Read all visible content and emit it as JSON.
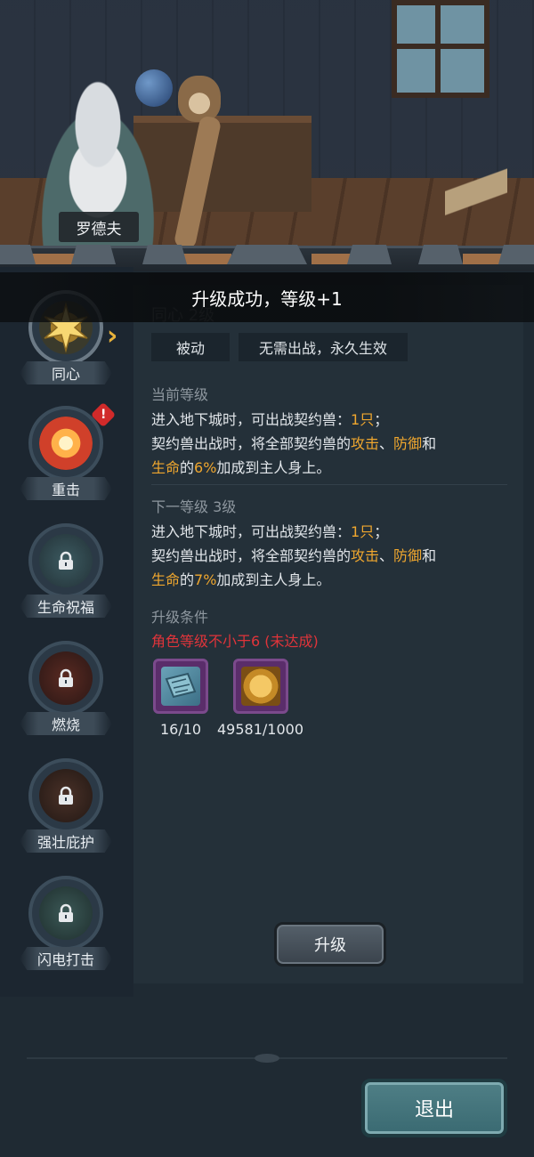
{
  "npc": {
    "name": "罗德夫"
  },
  "toast": {
    "text": "升级成功，等级+1"
  },
  "sidebar": {
    "skills": [
      {
        "label": "同心",
        "locked": false,
        "active": true,
        "icon": "sun-star-icon"
      },
      {
        "label": "重击",
        "locked": false,
        "active": false,
        "alert": "!",
        "icon": "burst-icon"
      },
      {
        "label": "生命祝福",
        "locked": true,
        "icon": "lock-icon"
      },
      {
        "label": "燃烧",
        "locked": true,
        "icon": "lock-icon"
      },
      {
        "label": "强壮庇护",
        "locked": true,
        "icon": "lock-icon"
      },
      {
        "label": "闪电打击",
        "locked": true,
        "icon": "lock-icon"
      }
    ]
  },
  "panel": {
    "skill_title": "同心 2级",
    "tags": [
      "被动",
      "无需出战，永久生效"
    ],
    "current": {
      "heading": "当前等级",
      "line1_pre": "进入地下城时，可出战契约兽：",
      "line1_hl": "1只",
      "line1_post": "；",
      "line2_pre": "契约兽出战时，将全部契约兽的",
      "line2_hl1": "攻击",
      "line2_sep": "、",
      "line2_hl2": "防御",
      "line2_post": "和",
      "line3_hl1": "生命",
      "line3_mid": "的",
      "line3_hl2": "6%",
      "line3_post": "加成到主人身上。"
    },
    "next": {
      "heading": "下一等级 3级",
      "line1_pre": "进入地下城时，可出战契约兽：",
      "line1_hl": "1只",
      "line1_post": "；",
      "line2_pre": "契约兽出战时，将全部契约兽的",
      "line2_hl1": "攻击",
      "line2_sep": "、",
      "line2_hl2": "防御",
      "line2_post": "和",
      "line3_hl1": "生命",
      "line3_mid": "的",
      "line3_hl2": "7%",
      "line3_post": "加成到主人身上。"
    },
    "requirements": {
      "heading": "升级条件",
      "condition": "角色等级不小于6 (未达成)",
      "items": [
        {
          "icon": "scroll-map-icon",
          "count": "16/10"
        },
        {
          "icon": "gold-coin-icon",
          "count": "49581/1000"
        }
      ]
    },
    "upgrade_button": "升级"
  },
  "exit_button": "退出",
  "colors": {
    "highlight": "#f0a72e",
    "requirement_unmet": "#e0343a",
    "panel_bg": "#243039"
  }
}
